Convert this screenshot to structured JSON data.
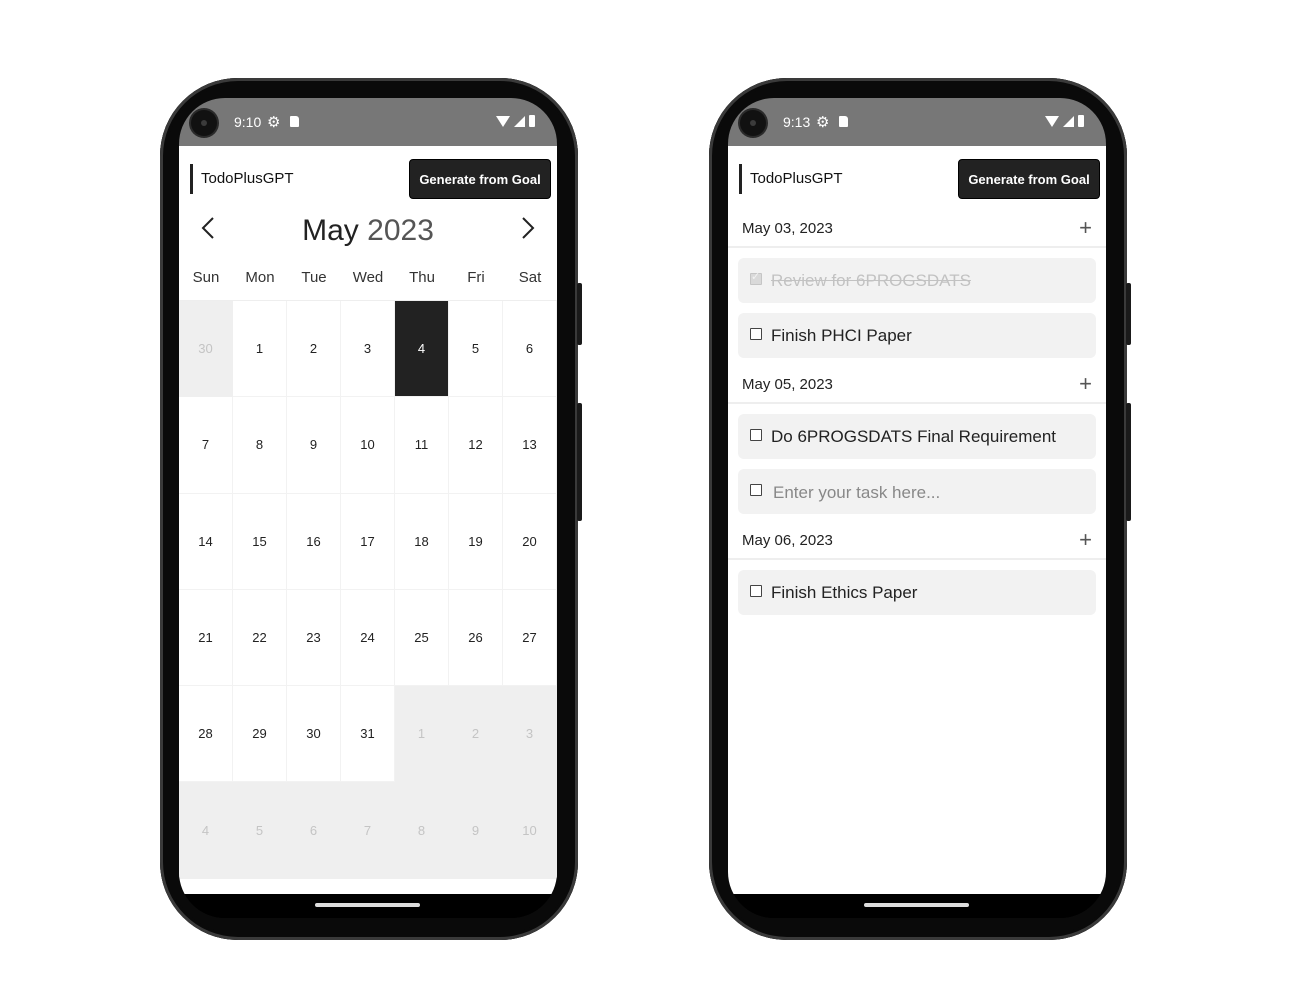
{
  "phones": [
    {
      "status": {
        "time": "9:10"
      },
      "app_title": "TodoPlusGPT",
      "generate_label": "Generate from Goal",
      "calendar": {
        "prev_icon": "chevron-left-icon",
        "next_icon": "chevron-right-icon",
        "month": "May",
        "year": "2023",
        "weekdays": [
          "Sun",
          "Mon",
          "Tue",
          "Wed",
          "Thu",
          "Fri",
          "Sat"
        ],
        "today": "4",
        "weeks": [
          [
            {
              "d": "30",
              "o": true
            },
            {
              "d": "1"
            },
            {
              "d": "2"
            },
            {
              "d": "3"
            },
            {
              "d": "4"
            },
            {
              "d": "5"
            },
            {
              "d": "6"
            }
          ],
          [
            {
              "d": "7"
            },
            {
              "d": "8"
            },
            {
              "d": "9"
            },
            {
              "d": "10"
            },
            {
              "d": "11"
            },
            {
              "d": "12"
            },
            {
              "d": "13"
            }
          ],
          [
            {
              "d": "14"
            },
            {
              "d": "15"
            },
            {
              "d": "16"
            },
            {
              "d": "17"
            },
            {
              "d": "18"
            },
            {
              "d": "19"
            },
            {
              "d": "20"
            }
          ],
          [
            {
              "d": "21"
            },
            {
              "d": "22"
            },
            {
              "d": "23"
            },
            {
              "d": "24"
            },
            {
              "d": "25"
            },
            {
              "d": "26"
            },
            {
              "d": "27"
            }
          ],
          [
            {
              "d": "28"
            },
            {
              "d": "29"
            },
            {
              "d": "30"
            },
            {
              "d": "31"
            },
            {
              "d": "1",
              "o": true
            },
            {
              "d": "2",
              "o": true
            },
            {
              "d": "3",
              "o": true
            }
          ],
          [
            {
              "d": "4",
              "o": true
            },
            {
              "d": "5",
              "o": true
            },
            {
              "d": "6",
              "o": true
            },
            {
              "d": "7",
              "o": true
            },
            {
              "d": "8",
              "o": true
            },
            {
              "d": "9",
              "o": true
            },
            {
              "d": "10",
              "o": true
            }
          ]
        ]
      }
    },
    {
      "status": {
        "time": "9:13"
      },
      "app_title": "TodoPlusGPT",
      "generate_label": "Generate from Goal",
      "sections": [
        {
          "date": "May 03, 2023",
          "tasks": [
            {
              "text": "Review for 6PROGSDATS",
              "done": true
            },
            {
              "text": "Finish PHCI Paper",
              "done": false
            }
          ]
        },
        {
          "date": "May 05, 2023",
          "tasks": [
            {
              "text": "Do 6PROGSDATS Final Requirement",
              "done": false
            }
          ],
          "new_task_placeholder": "Enter your task here..."
        },
        {
          "date": "May 06, 2023",
          "tasks": [
            {
              "text": "Finish Ethics Paper",
              "done": false
            }
          ]
        }
      ]
    }
  ],
  "icons": {
    "add": "plus-icon",
    "checkbox": "checkbox-icon",
    "wifi": "wifi-icon",
    "signal": "signal-icon",
    "battery": "battery-icon",
    "settings": "gear-icon",
    "sd": "sd-card-icon"
  }
}
